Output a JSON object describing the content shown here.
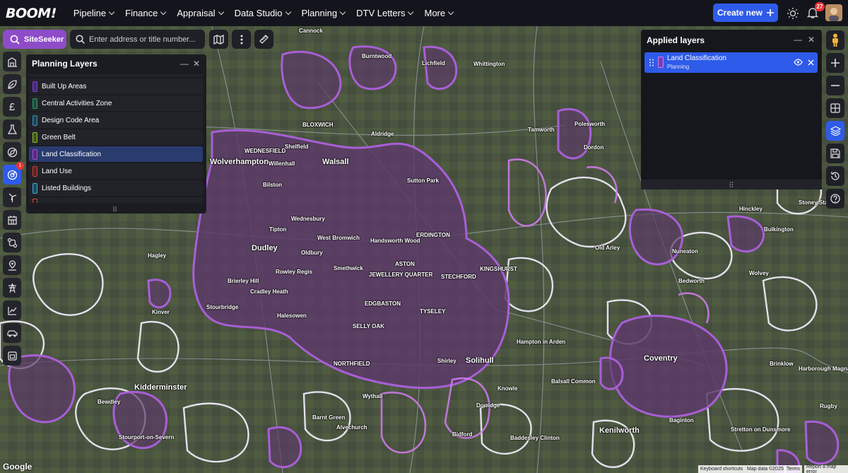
{
  "app": {
    "logo": "BOOM!"
  },
  "nav": [
    {
      "label": "Pipeline"
    },
    {
      "label": "Finance"
    },
    {
      "label": "Appraisal"
    },
    {
      "label": "Data Studio"
    },
    {
      "label": "Planning"
    },
    {
      "label": "DTV Letters"
    },
    {
      "label": "More"
    }
  ],
  "header": {
    "create_label": "Create new",
    "notification_count": "27"
  },
  "siteseeker": {
    "label": "SiteSeeker"
  },
  "search": {
    "placeholder": "Enter address or title number..."
  },
  "rail": {
    "badge": "1"
  },
  "planning_layers": {
    "title": "Planning Layers",
    "items": [
      {
        "label": "Built Up Areas",
        "color": "#7b3fd0"
      },
      {
        "label": "Central Activities Zone",
        "color": "#2d9a6a"
      },
      {
        "label": "Design Code Area",
        "color": "#3a8fb5"
      },
      {
        "label": "Green Belt",
        "color": "#8fbf2a"
      },
      {
        "label": "Land Classification",
        "color": "#a64ad8"
      },
      {
        "label": "Land Use",
        "color": "#c8423c"
      },
      {
        "label": "Listed Buildings",
        "color": "#4aa6d4"
      }
    ]
  },
  "applied_layers": {
    "title": "Applied layers",
    "items": [
      {
        "name": "Land Classification",
        "category": "Planning",
        "color": "#a64ad8"
      }
    ]
  },
  "map": {
    "labels": [
      "Cannock",
      "Burntwood",
      "Lichfield",
      "Whittington",
      "BLOXWICH",
      "Aldridge",
      "WEDNESFIELD",
      "Shelfield",
      "Wolverhampton",
      "Willenhall",
      "Walsall",
      "Sutton Park",
      "Bilston",
      "Wednesbury",
      "Tipton",
      "ERDINGTON",
      "Dudley",
      "West Bromwich",
      "Handsworth Wood",
      "Oldbury",
      "Smethwick",
      "ASTON",
      "Rowley Regis",
      "JEWELLERY QUARTER",
      "STECHFORD",
      "KINGSHURST",
      "Brierley Hill",
      "Cradley Heath",
      "Stourbridge",
      "Halesowen",
      "EDGBASTON",
      "TYSELEY",
      "SELLY OAK",
      "NORTHFIELD",
      "Shirley",
      "Solihull",
      "Hampton in Arden",
      "Coventry",
      "Kenilworth",
      "Kidderminster",
      "Hinckley",
      "Nuneaton",
      "Bedworth",
      "Bulkington",
      "Old Arley",
      "Polesworth",
      "Tamworth",
      "Dordon",
      "Rugby",
      "Stoney Stanton",
      "Balsall Common",
      "Alvechurch",
      "Barnt Green",
      "Knowle",
      "Dorridge",
      "Wythall",
      "Bewdley",
      "Stourport-on-Severn",
      "Hagley",
      "Kinver",
      "Baddesley Clinton",
      "Baginton",
      "Stretton on Dunsmore",
      "Brinklow",
      "Harborough Magna",
      "Wolvey",
      "Bidford"
    ]
  },
  "attribution": {
    "shortcuts": "Keyboard shortcuts",
    "data": "Map data ©2025",
    "terms": "Terms",
    "report": "Report a map error",
    "google": "Google"
  }
}
